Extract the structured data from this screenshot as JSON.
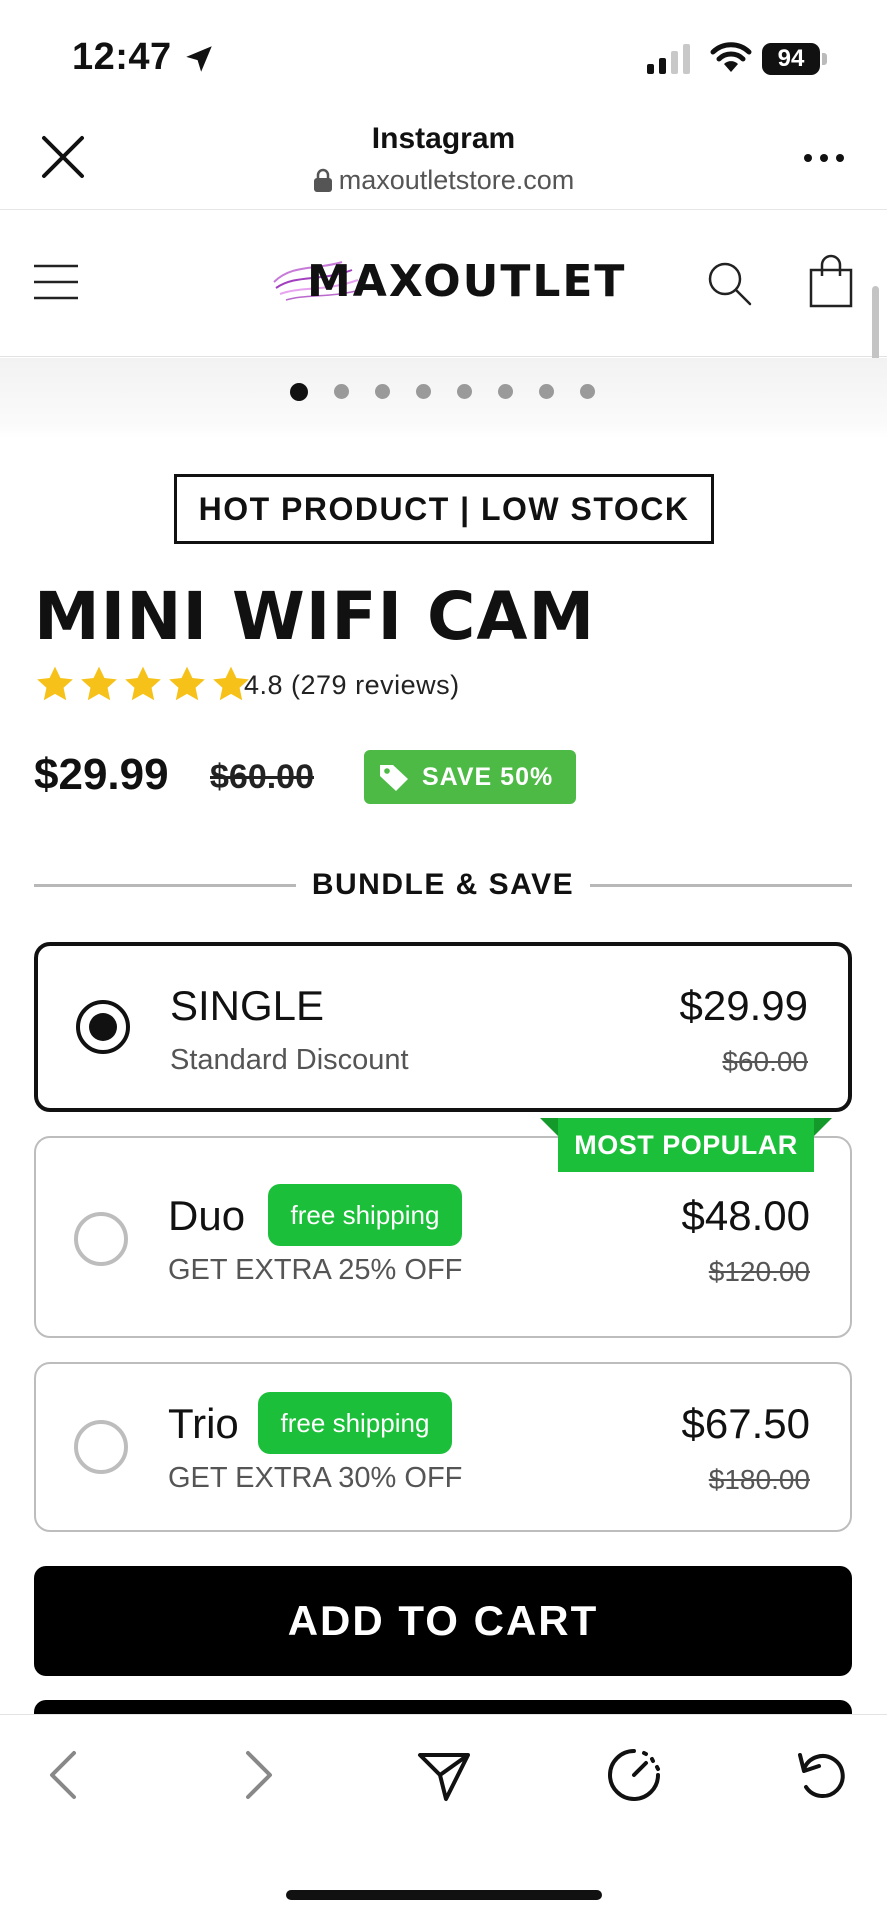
{
  "status_bar": {
    "time": "12:47",
    "battery": "94",
    "icons": [
      "location-arrow-icon",
      "signal-icon",
      "wifi-icon",
      "battery-icon"
    ]
  },
  "browser": {
    "title": "Instagram",
    "url": "maxoutletstore.com",
    "icons": [
      "close-icon",
      "lock-icon",
      "more-icon"
    ]
  },
  "store": {
    "logo": "MAXOUTLET",
    "icons": [
      "menu-icon",
      "search-icon",
      "shopping-bag-icon"
    ]
  },
  "carousel": {
    "total_slides": 8,
    "active_index": 0
  },
  "product": {
    "badge": "HOT PRODUCT | LOW STOCK",
    "title": "MINI WIFI CAM",
    "rating": 4.8,
    "rating_text": "4.8 (279 reviews)",
    "price": "$29.99",
    "compare_price": "$60.00",
    "save_label": "SAVE 50%"
  },
  "bundle": {
    "title": "BUNDLE & SAVE",
    "popular_label": "MOST POPULAR",
    "options": [
      {
        "name": "SINGLE",
        "subtitle": "Standard Discount",
        "price": "$29.99",
        "compare_price": "$60.00",
        "shipping": "",
        "selected": true
      },
      {
        "name": "Duo",
        "subtitle": "GET EXTRA 25% OFF",
        "price": "$48.00",
        "compare_price": "$120.00",
        "shipping": "free shipping",
        "selected": false
      },
      {
        "name": "Trio",
        "subtitle": "GET EXTRA 30% OFF",
        "price": "$67.50",
        "compare_price": "$180.00",
        "shipping": "free shipping",
        "selected": false
      }
    ]
  },
  "cta": {
    "add_to_cart": "ADD TO CART"
  },
  "toolbar": {
    "icons": [
      "back-icon",
      "forward-icon",
      "share-icon",
      "speed-icon",
      "reload-icon"
    ]
  },
  "colors": {
    "accent_green": "#1cbf3a",
    "save_green": "#4cba45",
    "star_yellow": "#f6c21a",
    "primary_black": "#000000"
  }
}
